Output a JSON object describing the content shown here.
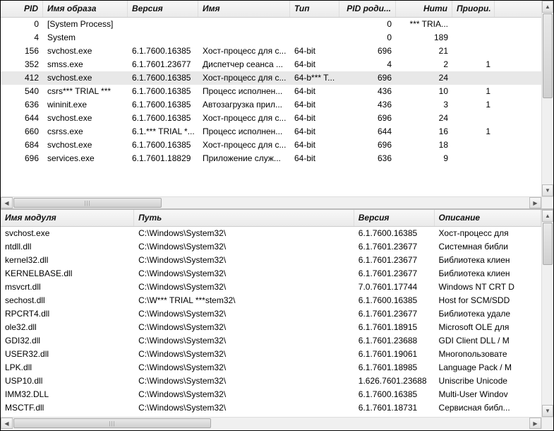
{
  "top": {
    "headers": {
      "pid": "PID",
      "image": "Имя образа",
      "version": "Версия",
      "name": "Имя",
      "type": "Тип",
      "parent": "PID роди...",
      "threads": "Нити",
      "prio": "Приори."
    },
    "rows": [
      {
        "pid": "0",
        "image": "[System Process]",
        "version": "",
        "name": "",
        "type": "",
        "parent": "0",
        "threads": "*** TRIA...",
        "prio": ""
      },
      {
        "pid": "4",
        "image": "System",
        "version": "",
        "name": "",
        "type": "",
        "parent": "0",
        "threads": "189",
        "prio": ""
      },
      {
        "pid": "156",
        "image": "svchost.exe",
        "version": "6.1.7600.16385",
        "name": "Хост-процесс для с...",
        "type": "64-bit",
        "parent": "696",
        "threads": "21",
        "prio": ""
      },
      {
        "pid": "352",
        "image": "smss.exe",
        "version": "6.1.7601.23677",
        "name": "Диспетчер сеанса ...",
        "type": "64-bit",
        "parent": "4",
        "threads": "2",
        "prio": "1"
      },
      {
        "pid": "412",
        "image": "svchost.exe",
        "version": "6.1.7600.16385",
        "name": "Хост-процесс для с...",
        "type": "64-b*** T...",
        "parent": "696",
        "threads": "24",
        "prio": "",
        "selected": true
      },
      {
        "pid": "540",
        "image": "csrs*** TRIAL ***",
        "version": "6.1.7600.16385",
        "name": "Процесс исполнен...",
        "type": "64-bit",
        "parent": "436",
        "threads": "10",
        "prio": "1"
      },
      {
        "pid": "636",
        "image": "wininit.exe",
        "version": "6.1.7600.16385",
        "name": "Автозагрузка прил...",
        "type": "64-bit",
        "parent": "436",
        "threads": "3",
        "prio": "1"
      },
      {
        "pid": "644",
        "image": "svchost.exe",
        "version": "6.1.7600.16385",
        "name": "Хост-процесс для с...",
        "type": "64-bit",
        "parent": "696",
        "threads": "24",
        "prio": ""
      },
      {
        "pid": "660",
        "image": "csrss.exe",
        "version": "6.1.*** TRIAL *...",
        "name": "Процесс исполнен...",
        "type": "64-bit",
        "parent": "644",
        "threads": "16",
        "prio": "1"
      },
      {
        "pid": "684",
        "image": "svchost.exe",
        "version": "6.1.7600.16385",
        "name": "Хост-процесс для с...",
        "type": "64-bit",
        "parent": "696",
        "threads": "18",
        "prio": ""
      },
      {
        "pid": "696",
        "image": "services.exe",
        "version": "6.1.7601.18829",
        "name": "Приложение служ...",
        "type": "64-bit",
        "parent": "636",
        "threads": "9",
        "prio": ""
      }
    ]
  },
  "bottom": {
    "headers": {
      "module": "Имя модуля",
      "path": "Путь",
      "version": "Версия",
      "desc": "Описание"
    },
    "rows": [
      {
        "module": "svchost.exe",
        "path": "C:\\Windows\\System32\\",
        "version": "6.1.7600.16385",
        "desc": "Хост-процесс для"
      },
      {
        "module": "ntdll.dll",
        "path": "C:\\Windows\\System32\\",
        "version": "6.1.7601.23677",
        "desc": "Системная библи"
      },
      {
        "module": "kernel32.dll",
        "path": "C:\\Windows\\System32\\",
        "version": "6.1.7601.23677",
        "desc": "Библиотека клиен"
      },
      {
        "module": "KERNELBASE.dll",
        "path": "C:\\Windows\\System32\\",
        "version": "6.1.7601.23677",
        "desc": "Библиотека клиен"
      },
      {
        "module": "msvcrt.dll",
        "path": "C:\\Windows\\System32\\",
        "version": "7.0.7601.17744",
        "desc": "Windows NT CRT D"
      },
      {
        "module": "sechost.dll",
        "path": "C:\\W*** TRIAL ***stem32\\",
        "version": "6.1.7600.16385",
        "desc": "Host for SCM/SDD"
      },
      {
        "module": "RPCRT4.dll",
        "path": "C:\\Windows\\System32\\",
        "version": "6.1.7601.23677",
        "desc": "Библиотека удале"
      },
      {
        "module": "ole32.dll",
        "path": "C:\\Windows\\System32\\",
        "version": "6.1.7601.18915",
        "desc": "Microsoft OLE для"
      },
      {
        "module": "GDI32.dll",
        "path": "C:\\Windows\\System32\\",
        "version": "6.1.7601.23688",
        "desc": "GDI Client DLL / M"
      },
      {
        "module": "USER32.dll",
        "path": "C:\\Windows\\System32\\",
        "version": "6.1.7601.19061",
        "desc": "Многопользовате"
      },
      {
        "module": "LPK.dll",
        "path": "C:\\Windows\\System32\\",
        "version": "6.1.7601.18985",
        "desc": "Language Pack / M"
      },
      {
        "module": "USP10.dll",
        "path": "C:\\Windows\\System32\\",
        "version": "1.626.7601.23688",
        "desc": "Uniscribe Unicode"
      },
      {
        "module": "IMM32.DLL",
        "path": "C:\\Windows\\System32\\",
        "version": "6.1.7600.16385",
        "desc": "Multi-User Windov"
      },
      {
        "module": "MSCTF.dll",
        "path": "C:\\Windows\\System32\\",
        "version": "6.1.7601.18731",
        "desc": "Сервисная библ..."
      }
    ]
  }
}
